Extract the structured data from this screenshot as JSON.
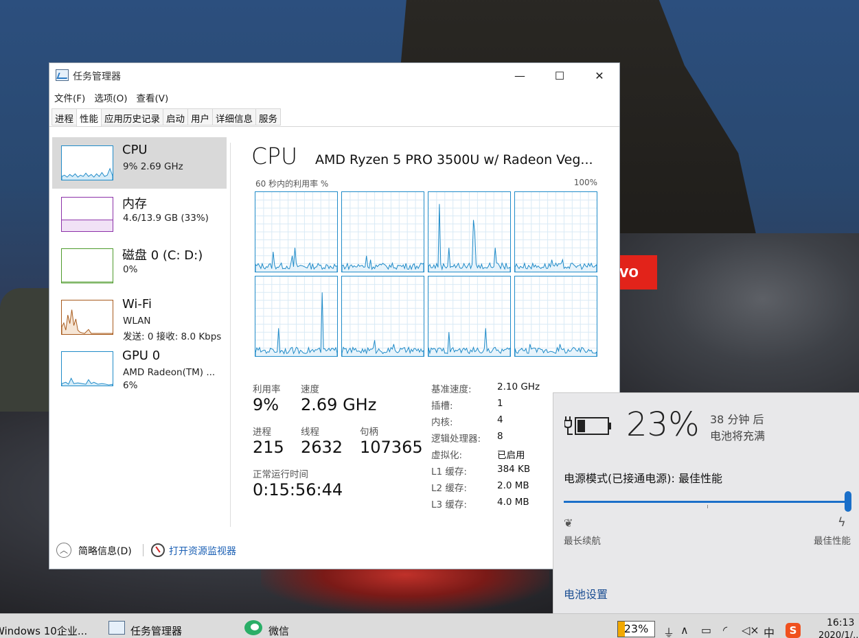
{
  "window": {
    "title": "任务管理器",
    "controls": {
      "minimize": "—",
      "maximize": "☐",
      "close": "✕"
    },
    "menu": [
      "文件(F)",
      "选项(O)",
      "查看(V)"
    ],
    "tabs": [
      "进程",
      "性能",
      "应用历史记录",
      "启动",
      "用户",
      "详细信息",
      "服务"
    ],
    "active_tab": "性能"
  },
  "sidebar": {
    "items": [
      {
        "title": "CPU",
        "sub": "9% 2.69 GHz",
        "sub2": "",
        "color": "#1e8ac8"
      },
      {
        "title": "内存",
        "sub": "4.6/13.9 GB (33%)",
        "sub2": "",
        "color": "#8b2fa8"
      },
      {
        "title": "磁盘 0 (C: D:)",
        "sub": "0%",
        "sub2": "",
        "color": "#4c9a2a"
      },
      {
        "title": "Wi-Fi",
        "sub": "WLAN",
        "sub2": "发送: 0 接收: 8.0 Kbps",
        "color": "#a7591a"
      },
      {
        "title": "GPU 0",
        "sub": "AMD Radeon(TM) ...",
        "sub2": "6%",
        "color": "#1e8ac8"
      }
    ]
  },
  "main": {
    "heading": "CPU",
    "model": "AMD Ryzen 5 PRO 3500U w/ Radeon Veg...",
    "graph_caption": "60 秒内的利用率 %",
    "graph_max": "100%",
    "stats": {
      "utilization_label": "利用率",
      "utilization": "9%",
      "speed_label": "速度",
      "speed": "2.69 GHz",
      "processes_label": "进程",
      "processes": "215",
      "threads_label": "线程",
      "threads": "2632",
      "handles_label": "句柄",
      "handles": "107365",
      "uptime_label": "正常运行时间",
      "uptime": "0:15:56:44"
    },
    "specs": [
      {
        "label": "基准速度:",
        "value": "2.10 GHz"
      },
      {
        "label": "插槽:",
        "value": "1"
      },
      {
        "label": "内核:",
        "value": "4"
      },
      {
        "label": "逻辑处理器:",
        "value": "8"
      },
      {
        "label": "虚拟化:",
        "value": "已启用"
      },
      {
        "label": "L1 缓存:",
        "value": "384 KB"
      },
      {
        "label": "L2 缓存:",
        "value": "2.0 MB"
      },
      {
        "label": "L3 缓存:",
        "value": "4.0 MB"
      }
    ]
  },
  "footer": {
    "fewer_details": "简略信息(D)",
    "open_resmon": "打开资源监视器"
  },
  "battery": {
    "percent": "23%",
    "time": "38 分钟  后",
    "status": "电池将充满",
    "power_mode": "电源模式(已接通电源): 最佳性能",
    "slider_level": 1.0,
    "left_label": "最长续航",
    "right_label": "最佳性能",
    "settings_link": "电池设置"
  },
  "taskbar": {
    "windows_item": "Windows 10企业...",
    "taskmgr_item": "任务管理器",
    "wechat_item": "微信",
    "battery_pct": "23%",
    "ime": "中",
    "time": "16:13",
    "date": "2020/1/..."
  },
  "desktop": {
    "brand_text": "vo"
  }
}
